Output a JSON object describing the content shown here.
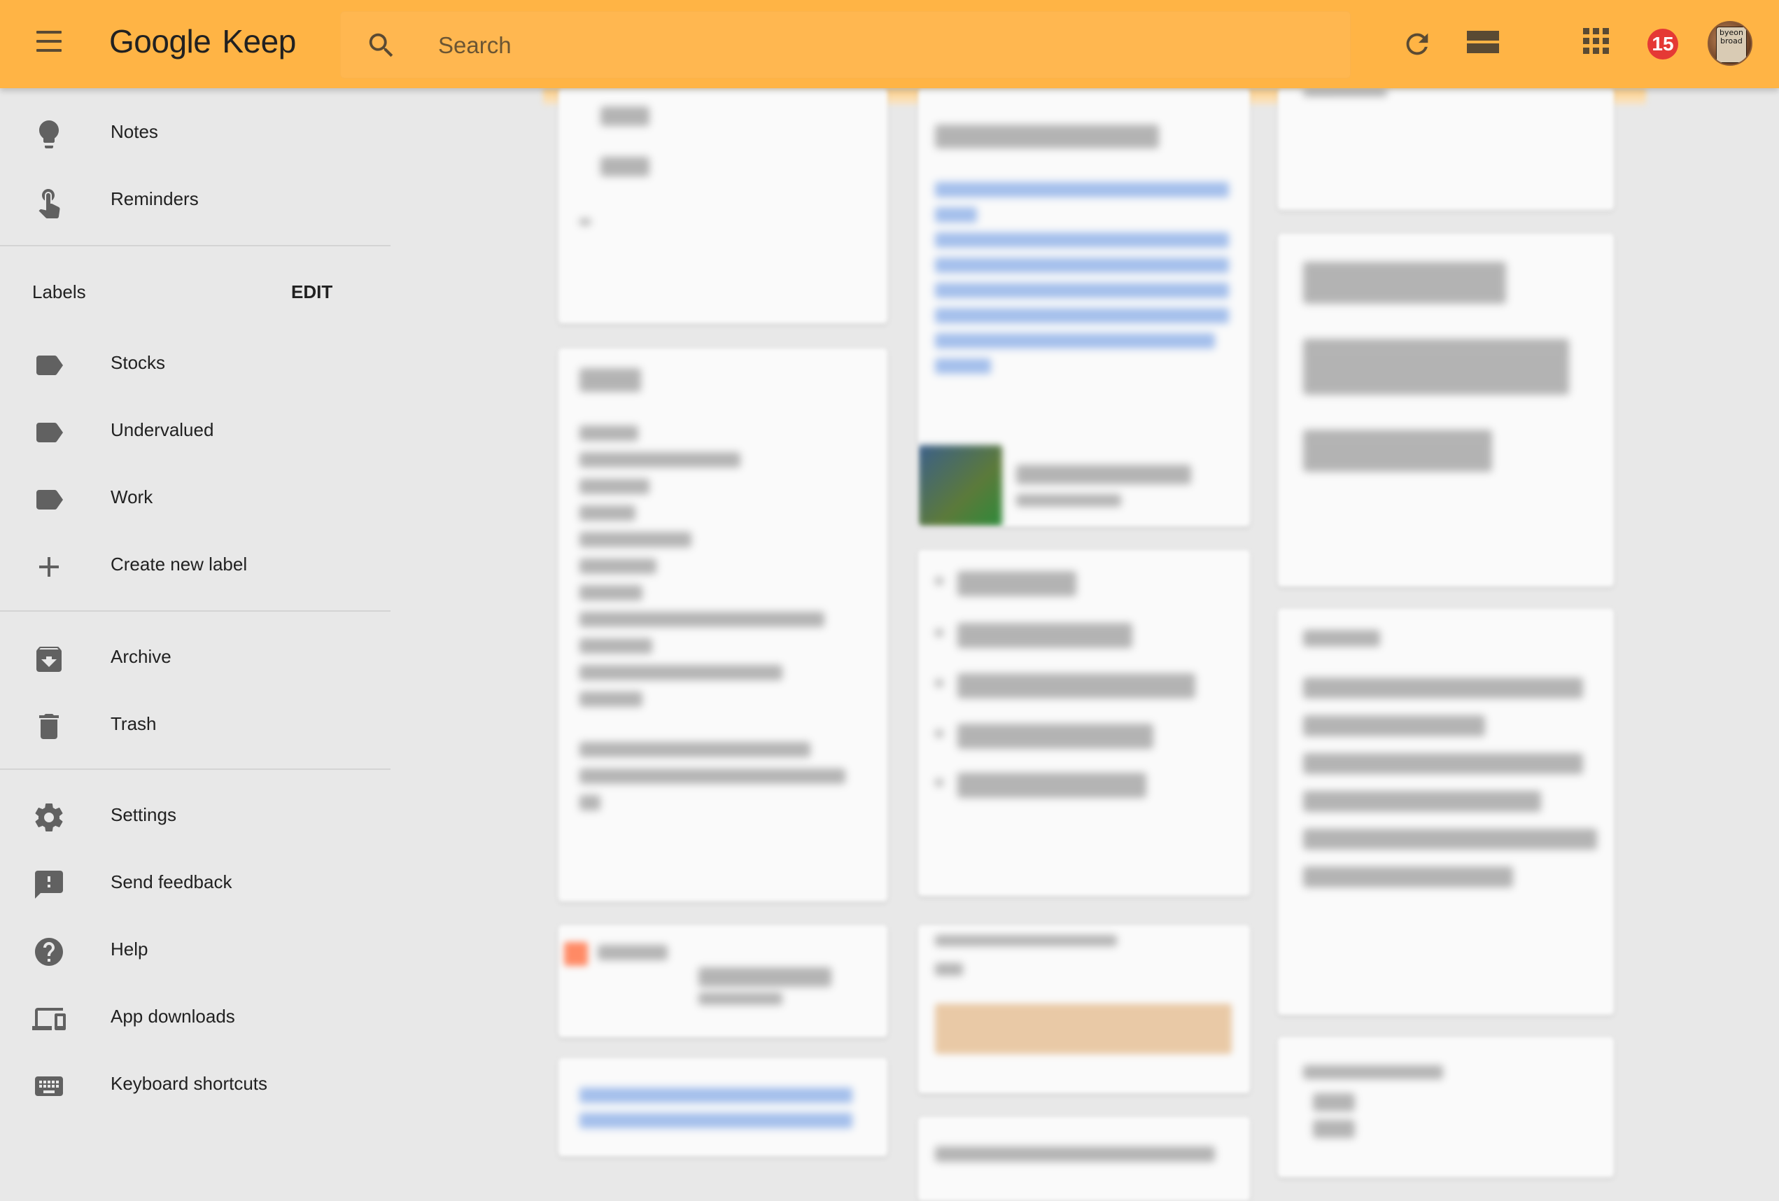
{
  "app": {
    "logo_google": "Google",
    "logo_keep": "Keep"
  },
  "search": {
    "placeholder": "Search"
  },
  "header": {
    "notification_count": "15",
    "avatar_text": "byeon broad"
  },
  "sidebar": {
    "primary": [
      {
        "label": "Notes",
        "icon": "lightbulb-icon"
      },
      {
        "label": "Reminders",
        "icon": "reminder-hand-icon"
      }
    ],
    "labels_heading": "Labels",
    "labels_edit": "EDIT",
    "labels": [
      {
        "label": "Stocks",
        "icon": "label-icon"
      },
      {
        "label": "Undervalued",
        "icon": "label-icon"
      },
      {
        "label": "Work",
        "icon": "label-icon"
      }
    ],
    "create_label": "Create new label",
    "archive": "Archive",
    "trash": "Trash",
    "settings": "Settings",
    "feedback": "Send feedback",
    "help": "Help",
    "app_downloads": "App downloads",
    "shortcuts": "Keyboard shortcuts"
  },
  "colors": {
    "header_bg": "#ffb445",
    "sidebar_bg": "#e8e8e8",
    "badge": "#e53935",
    "icon": "#616161"
  }
}
